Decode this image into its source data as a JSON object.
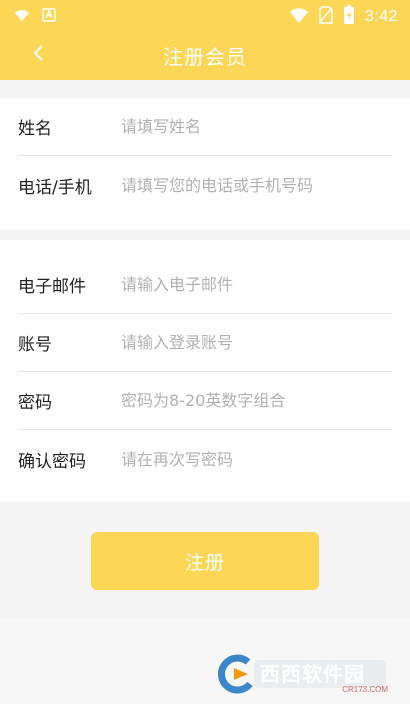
{
  "status_bar": {
    "time": "3:42"
  },
  "app_bar": {
    "title": "注册会员"
  },
  "form": {
    "rows": [
      {
        "label": "姓名",
        "placeholder": "请填写姓名"
      },
      {
        "label": "电话/手机",
        "placeholder": "请填写您的电话或手机号码"
      },
      {
        "label": "电子邮件",
        "placeholder": "请输入电子邮件"
      },
      {
        "label": "账号",
        "placeholder": "请输入登录账号"
      },
      {
        "label": "密码",
        "placeholder": "密码为8-20英数字组合"
      },
      {
        "label": "确认密码",
        "placeholder": "请在再次写密码"
      }
    ]
  },
  "submit": {
    "label": "注册"
  },
  "watermark": {
    "brand": "西西软件园",
    "domain": "CR173.COM"
  },
  "colors": {
    "accent": "#fcd657",
    "background": "#f4f4f5"
  }
}
